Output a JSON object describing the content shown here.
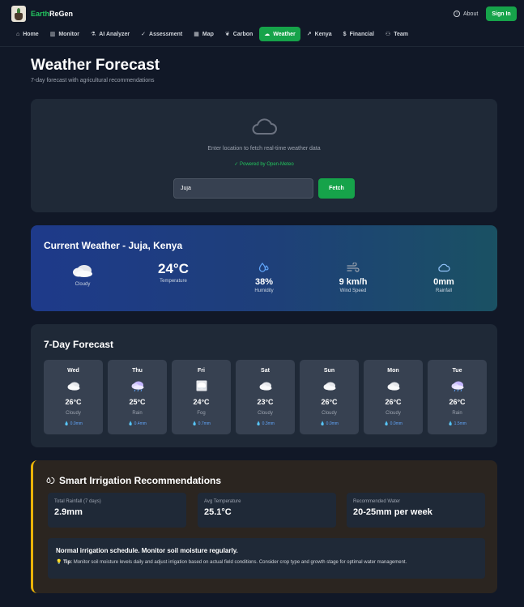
{
  "header": {
    "brand_part1": "Earth",
    "brand_part2": "ReGen",
    "about_label": "About",
    "signin_label": "Sign In"
  },
  "nav": [
    {
      "label": "Home",
      "icon": "home-icon",
      "active": false
    },
    {
      "label": "Monitor",
      "icon": "bar-chart-icon",
      "active": false
    },
    {
      "label": "AI Analyzer",
      "icon": "microscope-icon",
      "active": false
    },
    {
      "label": "Assessment",
      "icon": "check-circle-icon",
      "active": false
    },
    {
      "label": "Map",
      "icon": "map-icon",
      "active": false
    },
    {
      "label": "Carbon",
      "icon": "leaf-icon",
      "active": false
    },
    {
      "label": "Weather",
      "icon": "cloud-sun-icon",
      "active": true
    },
    {
      "label": "Kenya",
      "icon": "trend-icon",
      "active": false
    },
    {
      "label": "Financial",
      "icon": "dollar-icon",
      "active": false
    },
    {
      "label": "Team",
      "icon": "users-icon",
      "active": false
    }
  ],
  "page": {
    "title": "Weather Forecast",
    "subtitle": "7-day forecast with agricultural recommendations"
  },
  "search": {
    "hint": "Enter location to fetch real-time weather data",
    "powered_by": "✓ Powered by Open-Meteo",
    "location_value": "Juja",
    "fetch_label": "Fetch"
  },
  "current": {
    "title": "Current Weather - Juja, Kenya",
    "condition": "Cloudy",
    "temperature": "24°C",
    "temperature_label": "Temperature",
    "humidity": "38%",
    "humidity_label": "Humidity",
    "wind": "9 km/h",
    "wind_label": "Wind Speed",
    "rainfall": "0mm",
    "rainfall_label": "Rainfall"
  },
  "forecast": {
    "title": "7-Day Forecast",
    "days": [
      {
        "day": "Wed",
        "temp": "26°C",
        "condition": "Cloudy",
        "rain": "0.0mm",
        "icon": "cloudy"
      },
      {
        "day": "Thu",
        "temp": "25°C",
        "condition": "Rain",
        "rain": "0.4mm",
        "icon": "rain"
      },
      {
        "day": "Fri",
        "temp": "24°C",
        "condition": "Fog",
        "rain": "0.7mm",
        "icon": "fog"
      },
      {
        "day": "Sat",
        "temp": "23°C",
        "condition": "Cloudy",
        "rain": "0.3mm",
        "icon": "cloudy"
      },
      {
        "day": "Sun",
        "temp": "26°C",
        "condition": "Cloudy",
        "rain": "0.0mm",
        "icon": "cloudy"
      },
      {
        "day": "Mon",
        "temp": "26°C",
        "condition": "Cloudy",
        "rain": "0.0mm",
        "icon": "cloudy"
      },
      {
        "day": "Tue",
        "temp": "26°C",
        "condition": "Rain",
        "rain": "1.5mm",
        "icon": "rain"
      }
    ]
  },
  "irrigation": {
    "title": "Smart Irrigation Recommendations",
    "total_rainfall_label": "Total Rainfall (7 days)",
    "total_rainfall": "2.9mm",
    "avg_temp_label": "Avg Temperature",
    "avg_temp": "25.1°C",
    "water_label": "Recommended Water",
    "water": "20-25mm per week",
    "advice": "Normal irrigation schedule. Monitor soil moisture regularly.",
    "tip_label": "Tip:",
    "tip_text": "Monitor soil moisture levels daily and adjust irrigation based on actual field conditions. Consider crop type and growth stage for optimal water management."
  },
  "colors": {
    "accent": "#16a34a",
    "background": "#111827",
    "card": "#1f2937",
    "irrigation_border": "#eab308",
    "rain_text": "#60a5fa"
  }
}
